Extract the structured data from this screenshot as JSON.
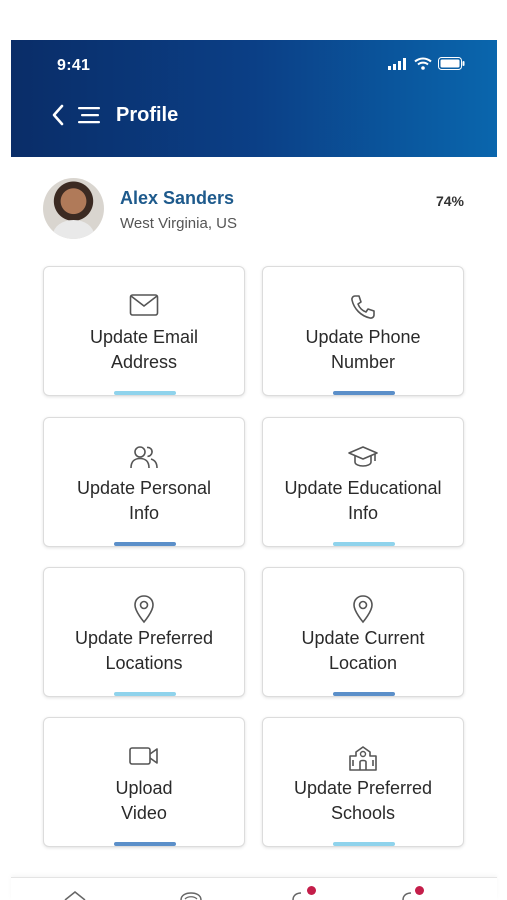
{
  "status_bar": {
    "time": "9:41"
  },
  "header": {
    "title": "Profile"
  },
  "profile": {
    "name": "Alex Sanders",
    "location": "West Virginia, US",
    "completion": "74%"
  },
  "cards": [
    {
      "label_line1": "Update Email",
      "label_line2": "Address",
      "icon": "envelope-icon",
      "bar_color": "#8fd3ec"
    },
    {
      "label_line1": "Update Phone",
      "label_line2": "Number",
      "icon": "phone-icon",
      "bar_color": "#5b8fc9"
    },
    {
      "label_line1": "Update Personal",
      "label_line2": "Info",
      "icon": "people-icon",
      "bar_color": "#5b8fc9"
    },
    {
      "label_line1": "Update Educational",
      "label_line2": "Info",
      "icon": "graduation-cap-icon",
      "bar_color": "#8fd3ec"
    },
    {
      "label_line1": "Update Preferred",
      "label_line2": "Locations",
      "icon": "location-pin-icon",
      "bar_color": "#8fd3ec"
    },
    {
      "label_line1": "Update Current",
      "label_line2": "Location",
      "icon": "location-pin-icon",
      "bar_color": "#5b8fc9"
    },
    {
      "label_line1": "Upload",
      "label_line2": "Video",
      "icon": "video-camera-icon",
      "bar_color": "#5b8fc9"
    },
    {
      "label_line1": "Update Preferred",
      "label_line2": "Schools",
      "icon": "school-building-icon",
      "bar_color": "#8fd3ec"
    }
  ],
  "colors": {
    "accent": "#1e5a8c",
    "badge": "#c41e4a"
  }
}
